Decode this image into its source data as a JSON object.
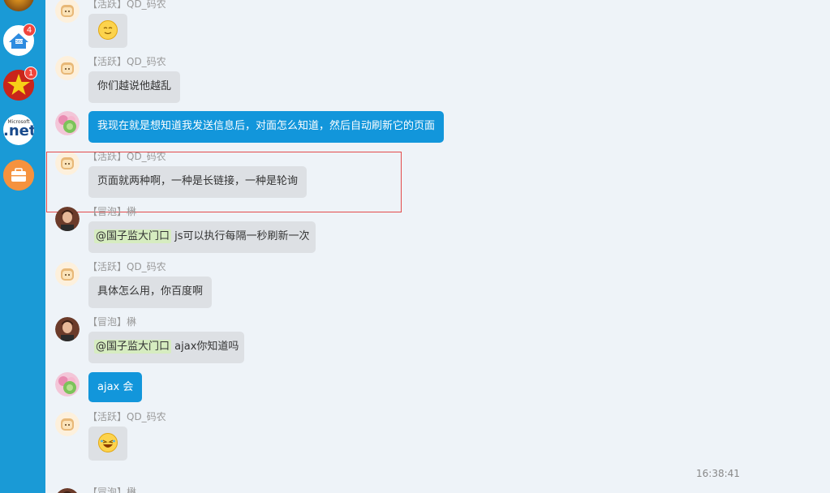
{
  "sidebar": {
    "apps": [
      {
        "name": "app-partial",
        "badge": ""
      },
      {
        "name": "360-app",
        "badge": "4"
      },
      {
        "name": "star-app",
        "badge": "1"
      },
      {
        "name": "dotnet-app",
        "label": ".net",
        "small": "Microsoft",
        "badge": ""
      },
      {
        "name": "briefcase-app",
        "badge": ""
      }
    ]
  },
  "chat": {
    "messages": [
      {
        "sender": "【活跃】QD_码农",
        "emoji": "smile"
      },
      {
        "sender": "【活跃】QD_码农",
        "text": "你们越说他越乱"
      },
      {
        "sender": "",
        "text": "我现在就是想知道我发送信息后，对面怎么知道，然后自动刷新它的页面",
        "self": true
      },
      {
        "sender": "【活跃】QD_码农",
        "text": "页面就两种啊，一种是长链接，一种是轮询"
      },
      {
        "sender": "【冒泡】楙",
        "mention": "@国子监大门口",
        "text": " js可以执行每隔一秒刷新一次"
      },
      {
        "sender": "【活跃】QD_码农",
        "text": "具体怎么用，你百度啊"
      },
      {
        "sender": "【冒泡】楙",
        "mention": "@国子监大门口",
        "text": " ajax你知道吗"
      },
      {
        "sender": "",
        "text": "ajax 会",
        "self": true
      },
      {
        "sender": "【活跃】QD_码农",
        "emoji": "laugh"
      },
      {
        "sender": "【冒泡】楙"
      }
    ],
    "timestamp": "16:38:41"
  },
  "colors": {
    "sidebar": "#1a9ad6",
    "self_bubble": "#1296db",
    "other_bubble": "#dde0e4",
    "highlight": "#e34a4a"
  }
}
